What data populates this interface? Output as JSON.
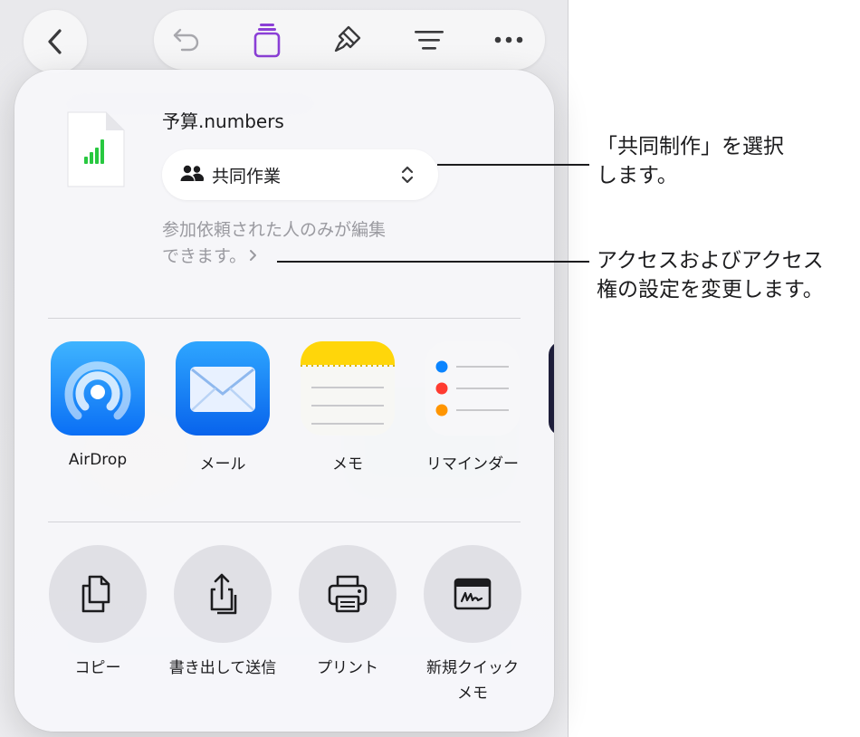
{
  "toolbar": {
    "back_icon": "chevron-left-icon",
    "icons": [
      "undo-icon",
      "share-icon",
      "format-brush-icon",
      "document-setup-icon",
      "more-icon"
    ],
    "accent_color": "#8b3fd6"
  },
  "share_sheet": {
    "file_name": "予算.numbers",
    "collaboration_option": "共同作業",
    "access_line1": "参加依頼された人のみが編集",
    "access_line2": "できます。",
    "apps": [
      {
        "label": "AirDrop",
        "icon": "airdrop-icon"
      },
      {
        "label": "メール",
        "icon": "mail-icon"
      },
      {
        "label": "メモ",
        "icon": "notes-icon"
      },
      {
        "label": "リマインダー",
        "icon": "reminders-icon"
      }
    ],
    "actions": [
      {
        "label": "コピー",
        "icon": "copy-icon"
      },
      {
        "label": "書き出して送信",
        "icon": "export-icon"
      },
      {
        "label": "プリント",
        "icon": "printer-icon"
      },
      {
        "label": "新規クイックメモ",
        "line1": "新規クイック",
        "line2": "メモ",
        "icon": "quick-note-icon"
      }
    ]
  },
  "callouts": [
    {
      "line1": "「共同制作」を選択",
      "line2": "します。"
    },
    {
      "line1": "アクセスおよびアクセス",
      "line2": "権の設定を変更します。"
    }
  ]
}
